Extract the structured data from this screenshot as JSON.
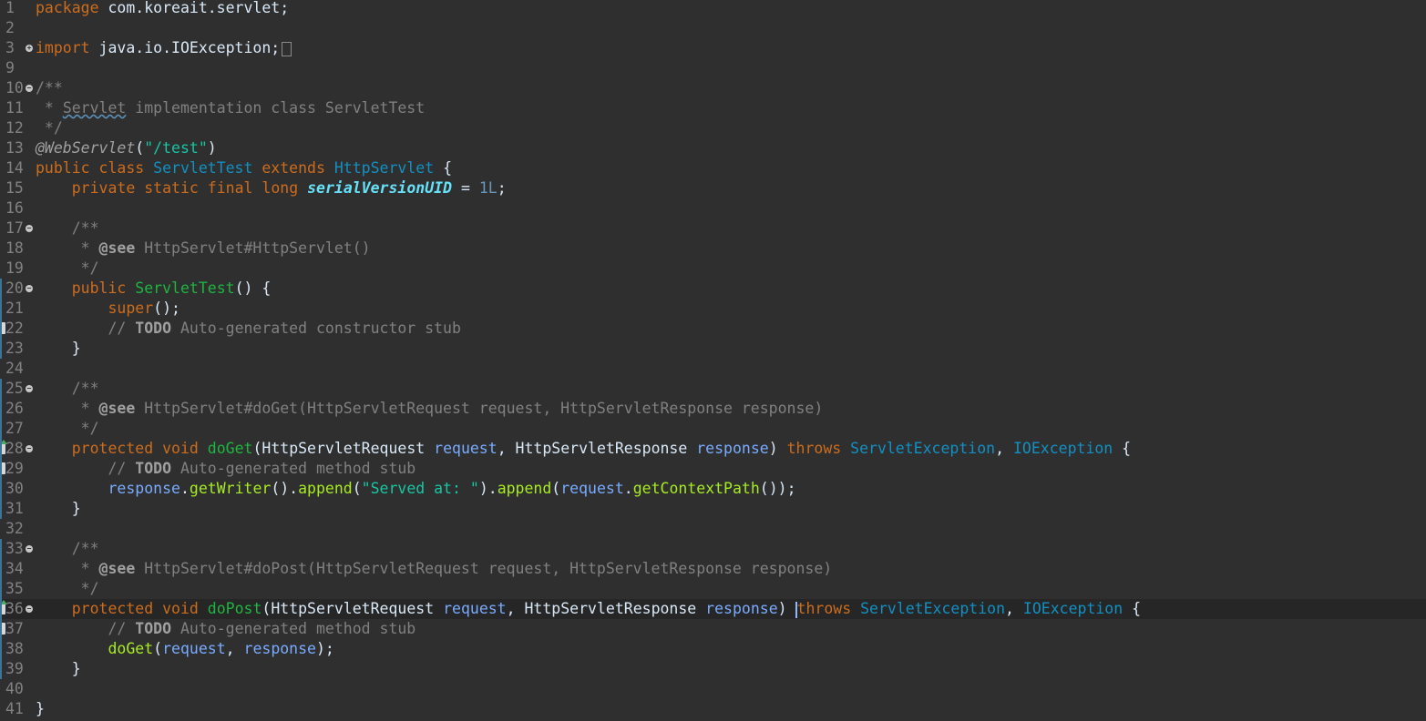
{
  "editor": {
    "language": "java",
    "current_line": 36,
    "lines": [
      {
        "n": "1",
        "tokens": [
          {
            "t": "package",
            "c": "kw"
          },
          {
            "t": " com.koreait.servlet;",
            "c": "plain"
          }
        ]
      },
      {
        "n": "2",
        "tokens": []
      },
      {
        "n": "3",
        "fold": "expand",
        "tokens": [
          {
            "t": "import",
            "c": "kw"
          },
          {
            "t": " java.io.IOException;",
            "c": "plain"
          }
        ],
        "collapsed": true
      },
      {
        "n": "9",
        "tokens": []
      },
      {
        "n": "10",
        "fold": "collapse",
        "tokens": [
          {
            "t": "/**",
            "c": "cmt"
          }
        ]
      },
      {
        "n": "11",
        "tokens": [
          {
            "t": " * ",
            "c": "cmt"
          },
          {
            "t": "Servlet",
            "c": "cmt",
            "spell": true
          },
          {
            "t": " implementation class ServletTest",
            "c": "cmt"
          }
        ]
      },
      {
        "n": "12",
        "tokens": [
          {
            "t": " */",
            "c": "cmt"
          }
        ]
      },
      {
        "n": "13",
        "tokens": [
          {
            "t": "@WebServlet",
            "c": "anno"
          },
          {
            "t": "(",
            "c": "plain"
          },
          {
            "t": "\"/test\"",
            "c": "str"
          },
          {
            "t": ")",
            "c": "plain"
          }
        ]
      },
      {
        "n": "14",
        "tokens": [
          {
            "t": "public",
            "c": "kw"
          },
          {
            "t": " ",
            "c": "plain"
          },
          {
            "t": "class",
            "c": "kw"
          },
          {
            "t": " ",
            "c": "plain"
          },
          {
            "t": "ServletTest",
            "c": "cls"
          },
          {
            "t": " ",
            "c": "plain"
          },
          {
            "t": "extends",
            "c": "kw"
          },
          {
            "t": " ",
            "c": "plain"
          },
          {
            "t": "HttpServlet",
            "c": "cls"
          },
          {
            "t": " {",
            "c": "plain"
          }
        ]
      },
      {
        "n": "15",
        "tokens": [
          {
            "t": "    ",
            "c": "plain"
          },
          {
            "t": "private",
            "c": "kw"
          },
          {
            "t": " ",
            "c": "plain"
          },
          {
            "t": "static",
            "c": "kw"
          },
          {
            "t": " ",
            "c": "plain"
          },
          {
            "t": "final",
            "c": "kw"
          },
          {
            "t": " ",
            "c": "plain"
          },
          {
            "t": "long",
            "c": "kw"
          },
          {
            "t": " ",
            "c": "plain"
          },
          {
            "t": "serialVersionUID",
            "c": "field"
          },
          {
            "t": " = ",
            "c": "plain"
          },
          {
            "t": "1L",
            "c": "num"
          },
          {
            "t": ";",
            "c": "plain"
          }
        ]
      },
      {
        "n": "16",
        "tokens": []
      },
      {
        "n": "17",
        "fold": "collapse",
        "tokens": [
          {
            "t": "    /**",
            "c": "cmt"
          }
        ]
      },
      {
        "n": "18",
        "tokens": [
          {
            "t": "     * ",
            "c": "cmt"
          },
          {
            "t": "@see",
            "c": "doctag"
          },
          {
            "t": " HttpServlet#HttpServlet()",
            "c": "cmt"
          }
        ]
      },
      {
        "n": "19",
        "tokens": [
          {
            "t": "     */",
            "c": "cmt"
          }
        ]
      },
      {
        "n": "20",
        "fold": "collapse",
        "tokens": [
          {
            "t": "    ",
            "c": "plain"
          },
          {
            "t": "public",
            "c": "kw"
          },
          {
            "t": " ",
            "c": "plain"
          },
          {
            "t": "ServletTest",
            "c": "mdecl"
          },
          {
            "t": "() {",
            "c": "plain"
          }
        ]
      },
      {
        "n": "21",
        "tokens": [
          {
            "t": "        ",
            "c": "plain"
          },
          {
            "t": "super",
            "c": "kw"
          },
          {
            "t": "();",
            "c": "plain"
          }
        ]
      },
      {
        "n": "22",
        "marker": "task",
        "tokens": [
          {
            "t": "        // ",
            "c": "cmt"
          },
          {
            "t": "TODO",
            "c": "todo"
          },
          {
            "t": " Auto-generated constructor stub",
            "c": "cmt"
          }
        ]
      },
      {
        "n": "23",
        "tokens": [
          {
            "t": "    }",
            "c": "plain"
          }
        ]
      },
      {
        "n": "24",
        "tokens": []
      },
      {
        "n": "25",
        "fold": "collapse",
        "tokens": [
          {
            "t": "    /**",
            "c": "cmt"
          }
        ]
      },
      {
        "n": "26",
        "tokens": [
          {
            "t": "     * ",
            "c": "cmt"
          },
          {
            "t": "@see",
            "c": "doctag"
          },
          {
            "t": " HttpServlet#doGet(HttpServletRequest request, HttpServletResponse response)",
            "c": "cmt"
          }
        ]
      },
      {
        "n": "27",
        "tokens": [
          {
            "t": "     */",
            "c": "cmt"
          }
        ]
      },
      {
        "n": "28",
        "fold": "collapse",
        "marker": "override",
        "tokens": [
          {
            "t": "    ",
            "c": "plain"
          },
          {
            "t": "protected",
            "c": "kw"
          },
          {
            "t": " ",
            "c": "plain"
          },
          {
            "t": "void",
            "c": "kw"
          },
          {
            "t": " ",
            "c": "plain"
          },
          {
            "t": "doGet",
            "c": "mdecl"
          },
          {
            "t": "(HttpServletRequest ",
            "c": "plain"
          },
          {
            "t": "request",
            "c": "param"
          },
          {
            "t": ", HttpServletResponse ",
            "c": "plain"
          },
          {
            "t": "response",
            "c": "param"
          },
          {
            "t": ") ",
            "c": "plain"
          },
          {
            "t": "throws",
            "c": "kw"
          },
          {
            "t": " ",
            "c": "plain"
          },
          {
            "t": "ServletException",
            "c": "cls"
          },
          {
            "t": ", ",
            "c": "plain"
          },
          {
            "t": "IOException",
            "c": "cls"
          },
          {
            "t": " {",
            "c": "plain"
          }
        ]
      },
      {
        "n": "29",
        "marker": "task",
        "tokens": [
          {
            "t": "        // ",
            "c": "cmt"
          },
          {
            "t": "TODO",
            "c": "todo"
          },
          {
            "t": " Auto-generated method stub",
            "c": "cmt"
          }
        ]
      },
      {
        "n": "30",
        "tokens": [
          {
            "t": "        ",
            "c": "plain"
          },
          {
            "t": "response",
            "c": "param"
          },
          {
            "t": ".",
            "c": "plain"
          },
          {
            "t": "getWriter",
            "c": "method"
          },
          {
            "t": "().",
            "c": "plain"
          },
          {
            "t": "append",
            "c": "method"
          },
          {
            "t": "(",
            "c": "plain"
          },
          {
            "t": "\"Served at: \"",
            "c": "str"
          },
          {
            "t": ").",
            "c": "plain"
          },
          {
            "t": "append",
            "c": "method"
          },
          {
            "t": "(",
            "c": "plain"
          },
          {
            "t": "request",
            "c": "param"
          },
          {
            "t": ".",
            "c": "plain"
          },
          {
            "t": "getContextPath",
            "c": "method"
          },
          {
            "t": "());",
            "c": "plain"
          }
        ]
      },
      {
        "n": "31",
        "tokens": [
          {
            "t": "    }",
            "c": "plain"
          }
        ]
      },
      {
        "n": "32",
        "tokens": []
      },
      {
        "n": "33",
        "fold": "collapse",
        "tokens": [
          {
            "t": "    /**",
            "c": "cmt"
          }
        ]
      },
      {
        "n": "34",
        "tokens": [
          {
            "t": "     * ",
            "c": "cmt"
          },
          {
            "t": "@see",
            "c": "doctag"
          },
          {
            "t": " HttpServlet#doPost(HttpServletRequest request, HttpServletResponse response)",
            "c": "cmt"
          }
        ]
      },
      {
        "n": "35",
        "tokens": [
          {
            "t": "     */",
            "c": "cmt"
          }
        ]
      },
      {
        "n": "36",
        "fold": "collapse",
        "marker": "override",
        "current": true,
        "tokens": [
          {
            "t": "    ",
            "c": "plain"
          },
          {
            "t": "protected",
            "c": "kw"
          },
          {
            "t": " ",
            "c": "plain"
          },
          {
            "t": "void",
            "c": "kw"
          },
          {
            "t": " ",
            "c": "plain"
          },
          {
            "t": "doPost",
            "c": "mdecl"
          },
          {
            "t": "(HttpServletRequest ",
            "c": "plain"
          },
          {
            "t": "request",
            "c": "param"
          },
          {
            "t": ", HttpServletResponse ",
            "c": "plain"
          },
          {
            "t": "response",
            "c": "param"
          },
          {
            "t": ") ",
            "c": "plain"
          },
          {
            "t": "CARET",
            "c": "caret"
          },
          {
            "t": "throws",
            "c": "kw"
          },
          {
            "t": " ",
            "c": "plain"
          },
          {
            "t": "ServletException",
            "c": "cls"
          },
          {
            "t": ", ",
            "c": "plain"
          },
          {
            "t": "IOException",
            "c": "cls"
          },
          {
            "t": " {",
            "c": "plain"
          }
        ]
      },
      {
        "n": "37",
        "marker": "task",
        "tokens": [
          {
            "t": "        // ",
            "c": "cmt"
          },
          {
            "t": "TODO",
            "c": "todo"
          },
          {
            "t": " Auto-generated method stub",
            "c": "cmt"
          }
        ]
      },
      {
        "n": "38",
        "tokens": [
          {
            "t": "        ",
            "c": "plain"
          },
          {
            "t": "doGet",
            "c": "method"
          },
          {
            "t": "(",
            "c": "plain"
          },
          {
            "t": "request",
            "c": "param"
          },
          {
            "t": ", ",
            "c": "plain"
          },
          {
            "t": "response",
            "c": "param"
          },
          {
            "t": ");",
            "c": "plain"
          }
        ]
      },
      {
        "n": "39",
        "tokens": [
          {
            "t": "    }",
            "c": "plain"
          }
        ]
      },
      {
        "n": "40",
        "tokens": []
      },
      {
        "n": "41",
        "tokens": [
          {
            "t": "}",
            "c": "plain"
          }
        ]
      }
    ]
  }
}
